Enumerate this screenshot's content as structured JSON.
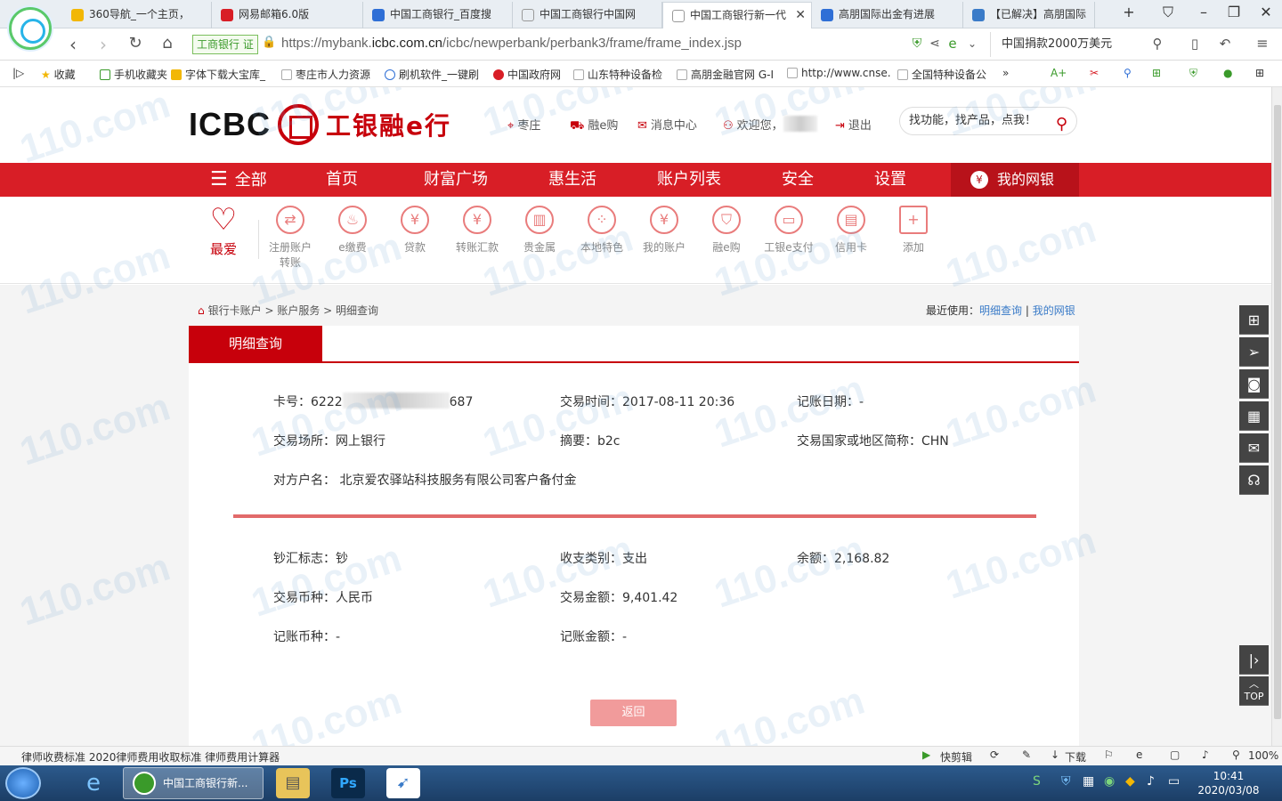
{
  "browser": {
    "tabs": [
      {
        "title": "360导航_一个主页，"
      },
      {
        "title": "网易邮箱6.0版"
      },
      {
        "title": "中国工商银行_百度搜"
      },
      {
        "title": "中国工商银行中国网"
      },
      {
        "title": "中国工商银行新一代"
      },
      {
        "title": "高朋国际出金有进展"
      },
      {
        "title": "【已解决】高朋国际"
      }
    ],
    "security_badge": "工商银行 证",
    "url_prefix": "https://mybank.",
    "url_domain": "icbc.com.cn",
    "url_path": "/icbc/newperbank/perbank3/frame/frame_index.jsp",
    "search_text": "中国捐款2000万美元",
    "bookmarks": [
      "收藏",
      "手机收藏夹",
      "字体下载大宝库_",
      "枣庄市人力资源",
      "刷机软件_一键刷",
      "中国政府网",
      "山东特种设备检",
      "高朋金融官网 G-I",
      "http://www.cnse.",
      "全国特种设备公"
    ]
  },
  "header": {
    "logo_en": "ICBC",
    "logo_cn": "工银融e行",
    "location": "枣庄",
    "shop": "融e购",
    "messages": "消息中心",
    "welcome": "欢迎您，",
    "logout": "退出",
    "search_placeholder": "找功能，找产品，点我！"
  },
  "nav": {
    "all": "全部",
    "items": [
      "首页",
      "财富广场",
      "惠生活",
      "账户列表",
      "安全",
      "设置"
    ],
    "mybank": "我的网银"
  },
  "quick": {
    "favorite": "最爱",
    "items": [
      "注册账户转账",
      "e缴费",
      "贷款",
      "转账汇款",
      "贵金属",
      "本地特色",
      "我的账户",
      "融e购",
      "工银e支付",
      "信用卡",
      "添加"
    ]
  },
  "breadcrumb": {
    "parts": [
      "银行卡账户",
      "账户服务",
      "明细查询"
    ],
    "recent_label": "最近使用：",
    "recent_links": [
      "明细查询",
      "我的网银"
    ]
  },
  "detail": {
    "tab": "明细查询",
    "card_label": "卡号：",
    "card_prefix": "6222",
    "card_suffix": "687",
    "trade_time": "交易时间：2017-08-11 20:36",
    "post_date": "记账日期：-",
    "trade_place": "交易场所：网上银行",
    "summary": "摘要：b2c",
    "country": "交易国家或地区简称：CHN",
    "counterparty": "对方户名：  北京爱农驿站科技服务有限公司客户备付金",
    "cash_flag": "钞汇标志：钞",
    "io_type": "收支类别：支出",
    "balance": "余额：2,168.82",
    "currency": "交易币种：人民币",
    "amount": "交易金额：9,401.42",
    "post_currency": "记账币种：-",
    "post_amount": "记账金额：-",
    "back": "返回"
  },
  "status": {
    "text": "律师收费标准 2020律师费用收取标准 律师费用计算器",
    "quickcut": "快剪辑",
    "download": "下载",
    "zoom": "100%"
  },
  "taskbar": {
    "active_window": "中国工商银行新...",
    "time": "10:41",
    "date": "2020/03/08"
  },
  "watermark": "110.com"
}
